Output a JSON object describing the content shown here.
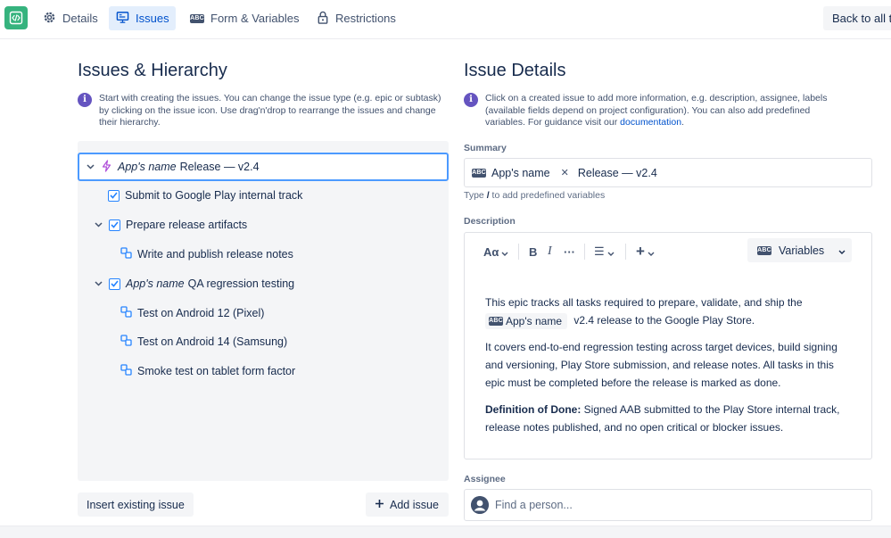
{
  "nav": {
    "tabs": [
      {
        "label": "Details",
        "icon": "gear-icon"
      },
      {
        "label": "Issues",
        "icon": "monitor-icon",
        "active": true
      },
      {
        "label": "Form & Variables",
        "icon": "abc-icon"
      },
      {
        "label": "Restrictions",
        "icon": "lock-icon"
      }
    ],
    "back_label": "Back to all templates",
    "accent": "#0052cc",
    "logo_color": "#36b37e"
  },
  "left": {
    "title": "Issues & Hierarchy",
    "info": "Start with creating the issues. You can change the issue type (e.g. epic or subtask) by clicking on the issue icon. Use drag'n'drop to rearrange the issues and change their hierarchy.",
    "tree": [
      {
        "prefix": "App's name",
        "label": "Release — v2.4",
        "type": "epic",
        "expanded": true,
        "selected": true
      },
      {
        "prefix": "",
        "label": "Submit to Google Play internal track",
        "type": "task"
      },
      {
        "prefix": "",
        "label": "Prepare release artifacts",
        "type": "task",
        "expanded": true
      },
      {
        "prefix": "",
        "label": "Write and publish release notes",
        "type": "subtask"
      },
      {
        "prefix": "App's name",
        "label": "QA regression testing",
        "type": "task",
        "expanded": true
      },
      {
        "prefix": "",
        "label": "Test on Android 12 (Pixel)",
        "type": "subtask"
      },
      {
        "prefix": "",
        "label": "Test on Android 14 (Samsung)",
        "type": "subtask"
      },
      {
        "prefix": "",
        "label": "Smoke test on tablet form factor",
        "type": "subtask"
      }
    ],
    "insert_label": "Insert existing issue",
    "add_label": "Add issue"
  },
  "right": {
    "title": "Issue Details",
    "info_text": "Click on a created issue to add more information, e.g. description, assignee, labels (available fields depend on project configuration). You can also add predefined variables. For guidance visit our",
    "info_link": "documentation",
    "info_end": ".",
    "summary_label": "Summary",
    "summary_chip": "App's name",
    "summary_value": "Release — v2.4",
    "hint_pre": "Type",
    "hint_key": "/",
    "hint_post": "to add predefined variables",
    "description_label": "Description",
    "toolbar": {
      "text_style": "Aα",
      "bold": "B",
      "italic": "I",
      "more": "···",
      "list": "☰",
      "insert": "+",
      "variables": "Variables"
    },
    "description": {
      "p1_a": "This epic tracks all tasks required to prepare, validate, and ship the",
      "p1_chip": "App's name",
      "p1_b": "v2.4 release to the Google Play Store.",
      "p2": "It covers end-to-end regression testing across target devices, build signing and versioning, Play Store submission, and release notes. All tasks in this epic must be completed before the release is marked as done.",
      "p3_bold": "Definition of Done:",
      "p3_text": "Signed AAB submitted to the Play Store internal track, release notes published, and no open critical or blocker issues."
    },
    "assignee_label": "Assignee",
    "assignee_placeholder": "Find a person..."
  },
  "abc_badge": "ABC"
}
